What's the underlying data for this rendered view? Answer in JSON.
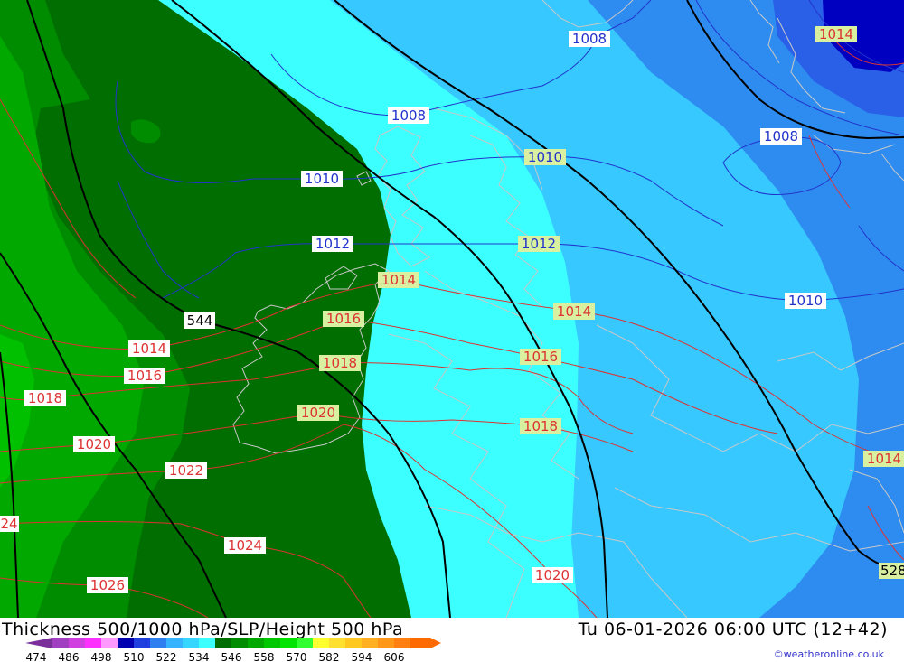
{
  "footer": {
    "title": "Thickness 500/1000 hPa/SLP/Height 500 hPa",
    "valid_time": "Tu 06-01-2026 06:00 UTC (12+42)",
    "credit": "©weatheronline.co.uk"
  },
  "legend": {
    "bins": [
      {
        "color": "#7a2f9a"
      },
      {
        "color": "#a040c0"
      },
      {
        "color": "#d040e0"
      },
      {
        "color": "#ff30ff"
      },
      {
        "color": "#ff99ff"
      },
      {
        "color": "#0000b0"
      },
      {
        "color": "#2040e0"
      },
      {
        "color": "#2e80f0"
      },
      {
        "color": "#36b4ff"
      },
      {
        "color": "#36d6ff"
      },
      {
        "color": "#3cffff"
      },
      {
        "color": "#006e00"
      },
      {
        "color": "#008c00"
      },
      {
        "color": "#00a800"
      },
      {
        "color": "#00c800"
      },
      {
        "color": "#00e400"
      },
      {
        "color": "#30ff30"
      },
      {
        "color": "#ffff30"
      },
      {
        "color": "#ffe030"
      },
      {
        "color": "#ffc820"
      },
      {
        "color": "#ffb020"
      },
      {
        "color": "#ff9818"
      },
      {
        "color": "#ff8010"
      },
      {
        "color": "#ff6a00"
      }
    ],
    "ticks": [
      "474",
      "486",
      "498",
      "510",
      "522",
      "534",
      "546",
      "558",
      "570",
      "582",
      "594",
      "606"
    ]
  },
  "slp_labels": [
    {
      "text": "1008",
      "style": "blue"
    },
    {
      "text": "1008",
      "style": "blue"
    },
    {
      "text": "1008",
      "style": "blue"
    },
    {
      "text": "1010",
      "style": "blue"
    },
    {
      "text": "1010",
      "style": "yellow"
    },
    {
      "text": "1010",
      "style": "blue"
    },
    {
      "text": "1012",
      "style": "blue"
    },
    {
      "text": "1012",
      "style": "yellow"
    },
    {
      "text": "1014",
      "style": "yellow"
    },
    {
      "text": "1014",
      "style": "yellow"
    },
    {
      "text": "1014",
      "style": "yellow"
    },
    {
      "text": "1014",
      "style": "red"
    },
    {
      "text": "1014",
      "style": "yellow"
    },
    {
      "text": "1016",
      "style": "yellow"
    },
    {
      "text": "1016",
      "style": "yellow"
    },
    {
      "text": "1016",
      "style": "red"
    },
    {
      "text": "1018",
      "style": "yellow"
    },
    {
      "text": "1018",
      "style": "yellow"
    },
    {
      "text": "1018",
      "style": "red"
    },
    {
      "text": "1020",
      "style": "yellow"
    },
    {
      "text": "1020",
      "style": "red"
    },
    {
      "text": "1020",
      "style": "red"
    },
    {
      "text": "1022",
      "style": "red"
    },
    {
      "text": "24",
      "style": "red"
    },
    {
      "text": "1024",
      "style": "red"
    },
    {
      "text": "1026",
      "style": "red"
    }
  ],
  "height_labels": [
    {
      "text": "544",
      "style": "black"
    },
    {
      "text": "528",
      "style": "yellow"
    }
  ],
  "colors": {
    "isobar_blue": "#2233cc",
    "isobar_red": "#dd3333",
    "height_contour": "#000000",
    "coastline": "#c8c8c8"
  }
}
